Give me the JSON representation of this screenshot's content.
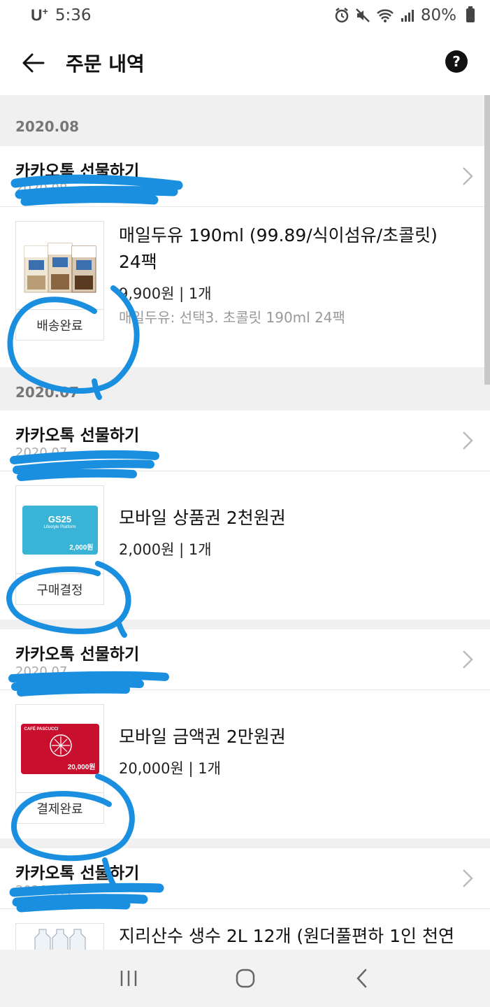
{
  "status_bar": {
    "carrier": "U",
    "carrier_sup": "+",
    "time": "5:36",
    "battery": "80%",
    "icons": [
      "alarm-icon",
      "mute-icon",
      "wifi-icon",
      "signal-icon",
      "battery-icon"
    ]
  },
  "app_bar": {
    "title": "주문 내역",
    "help_label": "?"
  },
  "sections": [
    {
      "date": "2020.08"
    },
    {
      "date": "2020.07"
    }
  ],
  "orders": [
    {
      "store": "카카오톡 선물하기",
      "date": "2020.08.",
      "title_line1": "매일두유 190ml (99.89/식이섬유/초콜릿)",
      "title_line2": "24팩",
      "price": "9,900원 | 1개",
      "option": "매일두유: 선택3. 초콜릿 190ml 24팩",
      "status": "배송완료"
    },
    {
      "store": "카카오톡 선물하기",
      "date": "2020.07.",
      "title_line1": "모바일 상품권 2천원권",
      "price": "2,000원 | 1개",
      "status": "구매결정",
      "thumb_brand": "GS25",
      "thumb_sub": "Lifestyle Platform",
      "thumb_value": "2,000원"
    },
    {
      "store": "카카오톡 선물하기",
      "date": "2020.07.",
      "title_line1": "모바일 금액권 2만원권",
      "price": "20,000원 | 1개",
      "status": "결제완료",
      "thumb_brand": "CAFÉ PASCUCCI",
      "thumb_value": "20,000원"
    },
    {
      "store": "카카오톡 선물하기",
      "date": "2020.07.",
      "title_line1": "지리산수 생수 2L 12개 (원더풀편하 1인 천연"
    }
  ],
  "colors": {
    "scribble": "#1a8fe0",
    "background": "#f0f0f0",
    "gs25_blue": "#3ab4d6",
    "pascucci_red": "#c8102e"
  }
}
